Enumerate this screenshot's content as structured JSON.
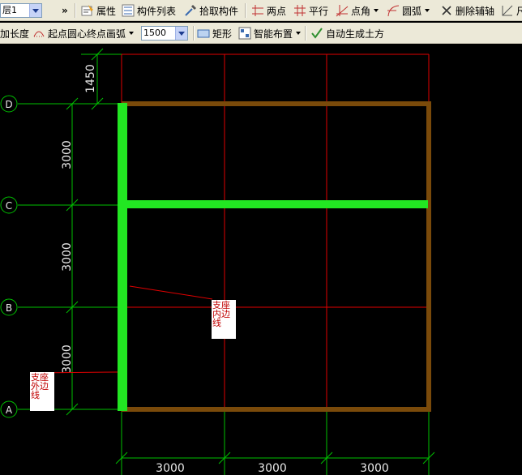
{
  "toolbar1": {
    "combo_value": "层1",
    "more_label": "»",
    "properties_label": "属性",
    "component_list_label": "构件列表",
    "pick_component_label": "拾取构件",
    "two_point_label": "两点",
    "parallel_label": "平行",
    "point_angle_label": "点角",
    "arc_label": "圆弧",
    "delete_axis_label": "删除辅轴",
    "last_label": "尺"
  },
  "toolbar2": {
    "extend_length_label": "加长度",
    "arc_mode_label": "起点圆心终点画弧",
    "radius_value": "1500",
    "rectangle_label": "矩形",
    "smart_layout_label": "智能布置",
    "auto_earthwork_label": "自动生成土方"
  },
  "drawing": {
    "grid_labels": [
      "D",
      "C",
      "B",
      "A"
    ],
    "vertical_dims": [
      "1450",
      "3000",
      "3000",
      "3000"
    ],
    "horizontal_dims": [
      "3000",
      "3000",
      "3000"
    ],
    "notes": {
      "inner": "支座内边线",
      "outer": "支座外边线"
    },
    "colors": {
      "background": "#000000",
      "grid_line": "#e00000",
      "dim_line": "#00c000",
      "beam_brown": "#7a4a0a",
      "support_green": "#22e622",
      "dim_text": "#e8e8e8"
    }
  }
}
